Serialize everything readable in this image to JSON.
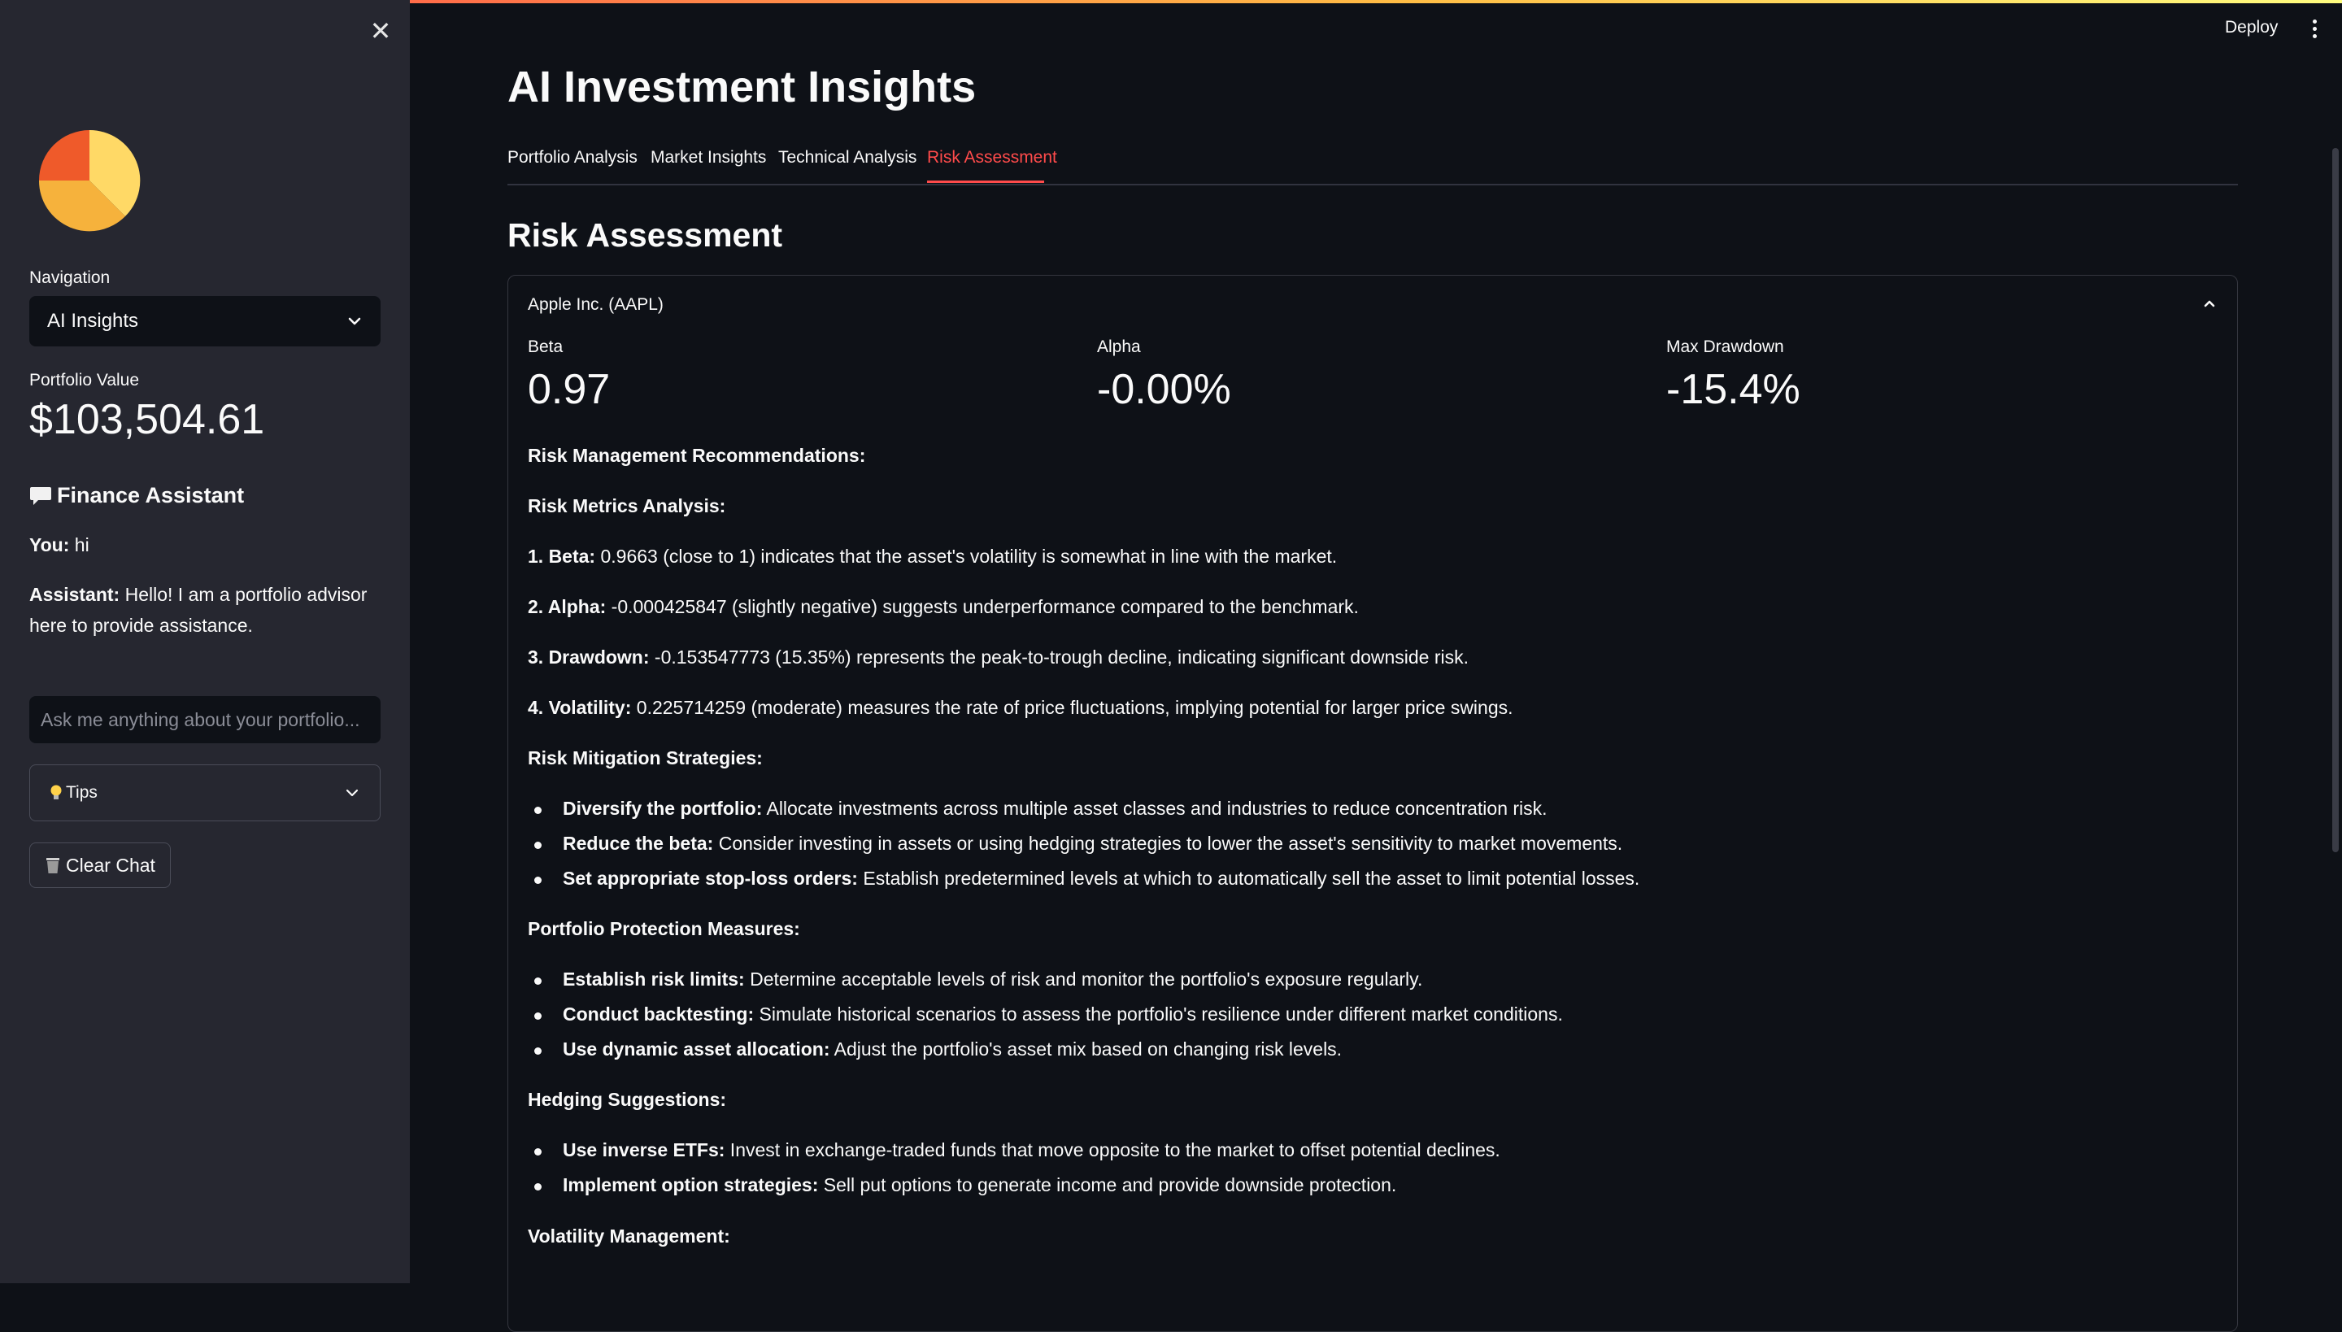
{
  "sidebar": {
    "navigation_label": "Navigation",
    "navigation_value": "AI Insights",
    "portfolio_label": "Portfolio Value",
    "portfolio_value": "$103,504.61",
    "assistant_title": "Finance Assistant",
    "chat": [
      {
        "speaker": "You:",
        "text": " hi"
      },
      {
        "speaker": "Assistant:",
        "text": " Hello! I am a portfolio advisor here to provide assistance."
      }
    ],
    "chat_placeholder": "Ask me anything about your portfolio...",
    "tips_label": "Tips",
    "clear_label": "Clear Chat",
    "logo_colors": [
      "#ffd966",
      "#f6b23c",
      "#ef5a2a"
    ]
  },
  "header": {
    "deploy_label": "Deploy"
  },
  "main": {
    "title": "AI Investment Insights",
    "tabs": [
      {
        "label": "Portfolio Analysis",
        "active": false
      },
      {
        "label": "Market Insights",
        "active": false
      },
      {
        "label": "Technical Analysis",
        "active": false
      },
      {
        "label": "Risk Assessment",
        "active": true
      }
    ],
    "section_title": "Risk Assessment",
    "expander_title": "Apple Inc. (AAPL)",
    "metrics": [
      {
        "label": "Beta",
        "value": "0.97"
      },
      {
        "label": "Alpha",
        "value": "-0.00%"
      },
      {
        "label": "Max Drawdown",
        "value": "-15.4%"
      }
    ],
    "headings": {
      "recommendations": "Risk Management Recommendations:",
      "metrics_analysis": "Risk Metrics Analysis:",
      "mitigation": "Risk Mitigation Strategies:",
      "protection": "Portfolio Protection Measures:",
      "hedging": "Hedging Suggestions:",
      "volatility": "Volatility Management:"
    },
    "analysis": [
      {
        "bold": "1. Beta:",
        "text": " 0.9663 (close to 1) indicates that the asset's volatility is somewhat in line with the market."
      },
      {
        "bold": "2. Alpha:",
        "text": " -0.000425847 (slightly negative) suggests underperformance compared to the benchmark."
      },
      {
        "bold": "3. Drawdown:",
        "text": " -0.153547773 (15.35%) represents the peak-to-trough decline, indicating significant downside risk."
      },
      {
        "bold": "4. Volatility:",
        "text": " 0.225714259 (moderate) measures the rate of price fluctuations, implying potential for larger price swings."
      }
    ],
    "mitigation": [
      {
        "bold": "Diversify the portfolio:",
        "text": " Allocate investments across multiple asset classes and industries to reduce concentration risk."
      },
      {
        "bold": "Reduce the beta:",
        "text": " Consider investing in assets or using hedging strategies to lower the asset's sensitivity to market movements."
      },
      {
        "bold": "Set appropriate stop-loss orders:",
        "text": " Establish predetermined levels at which to automatically sell the asset to limit potential losses."
      }
    ],
    "protection": [
      {
        "bold": "Establish risk limits:",
        "text": " Determine acceptable levels of risk and monitor the portfolio's exposure regularly."
      },
      {
        "bold": "Conduct backtesting:",
        "text": " Simulate historical scenarios to assess the portfolio's resilience under different market conditions."
      },
      {
        "bold": "Use dynamic asset allocation:",
        "text": " Adjust the portfolio's asset mix based on changing risk levels."
      }
    ],
    "hedging": [
      {
        "bold": "Use inverse ETFs:",
        "text": " Invest in exchange-traded funds that move opposite to the market to offset potential declines."
      },
      {
        "bold": "Implement option strategies:",
        "text": " Sell put options to generate income and provide downside protection."
      }
    ]
  },
  "colors": {
    "accent": "#ff4b4b",
    "sidebar_bg": "#262730",
    "main_bg": "#0e1117"
  }
}
